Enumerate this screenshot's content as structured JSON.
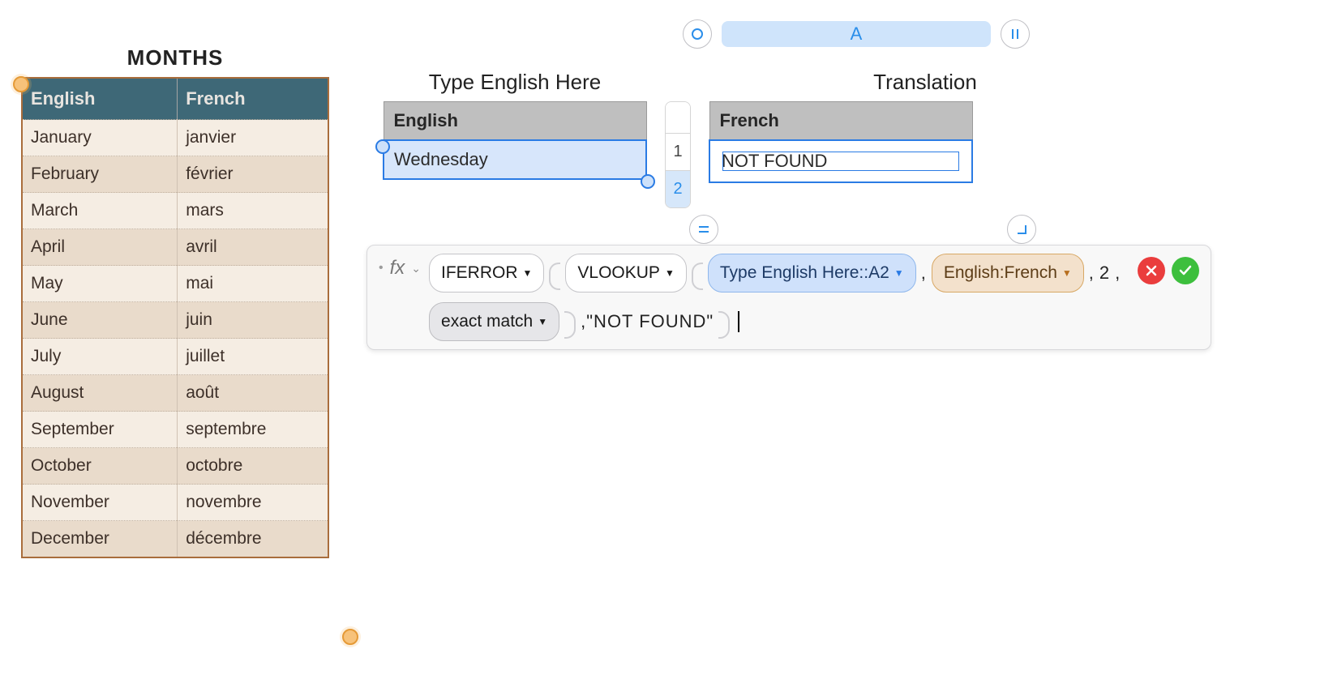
{
  "months": {
    "title": "MONTHS",
    "headers": {
      "col1": "English",
      "col2": "French"
    },
    "rows": [
      {
        "en": "January",
        "fr": "janvier"
      },
      {
        "en": "February",
        "fr": "février"
      },
      {
        "en": "March",
        "fr": "mars"
      },
      {
        "en": "April",
        "fr": "avril"
      },
      {
        "en": "May",
        "fr": "mai"
      },
      {
        "en": "June",
        "fr": "juin"
      },
      {
        "en": "July",
        "fr": "juillet"
      },
      {
        "en": "August",
        "fr": "août"
      },
      {
        "en": "September",
        "fr": "septembre"
      },
      {
        "en": "October",
        "fr": "octobre"
      },
      {
        "en": "November",
        "fr": "novembre"
      },
      {
        "en": "December",
        "fr": "décembre"
      }
    ]
  },
  "input_table": {
    "title": "Type English Here",
    "header": "English",
    "value": "Wednesday"
  },
  "output_table": {
    "title": "Translation",
    "header": "French",
    "value": "NOT FOUND"
  },
  "column_tab": {
    "label": "A"
  },
  "row_labels": {
    "r1": "1",
    "r2": "2"
  },
  "formula": {
    "fx_label": "fx",
    "iferror": "IFERROR",
    "vlookup": "VLOOKUP",
    "ref": "Type English Here::A2",
    "range": "English:French",
    "colnum": "2",
    "comma1": ",",
    "comma2": ",",
    "comma3": ",",
    "exact": "exact match",
    "notfound": "\"NOT FOUND\""
  },
  "chart_data": {
    "type": "table",
    "title": "MONTHS",
    "columns": [
      "English",
      "French"
    ],
    "rows": [
      [
        "January",
        "janvier"
      ],
      [
        "February",
        "février"
      ],
      [
        "March",
        "mars"
      ],
      [
        "April",
        "avril"
      ],
      [
        "May",
        "mai"
      ],
      [
        "June",
        "juin"
      ],
      [
        "July",
        "juillet"
      ],
      [
        "August",
        "août"
      ],
      [
        "September",
        "septembre"
      ],
      [
        "October",
        "octobre"
      ],
      [
        "November",
        "novembre"
      ],
      [
        "December",
        "décembre"
      ]
    ]
  }
}
